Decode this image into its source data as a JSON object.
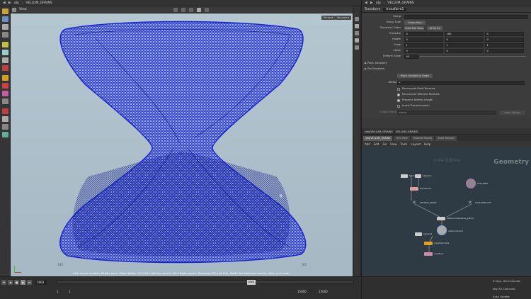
{
  "viewport": {
    "path": [
      "obj",
      "VELLUM_GRAINS"
    ],
    "title": "View",
    "persp_label": "Persp ▾",
    "cam_label": "No cam ▾",
    "grid_labels": [
      "-185",
      "185"
    ],
    "status_hint": "Left mouse tumbles. Middle pans. Right dollies. Ctrl+Alt+Left box-zooms. Ctrl+Right zooms. Spacebar-Ctrl-Left tilts. Hold L for alternate tumble, dolly, and zoom."
  },
  "timeline": {
    "current_frame": "1663",
    "marker_frame": "1663",
    "range_start": "1",
    "range_end": "15000"
  },
  "params": {
    "path": [
      "obj",
      "VELLUM_GRAINS"
    ],
    "node_type": "Transform",
    "node_name": "transform1",
    "fields": {
      "group": {
        "label": "Group"
      },
      "group_type": {
        "label": "Group Type",
        "value": "Guess from Group"
      },
      "transform_order": {
        "label": "Transform Order",
        "value": "Scale Rot Trans"
      },
      "rotate_order": {
        "value": "Rx Ry Rz"
      },
      "translate": {
        "label": "Translate",
        "values": [
          "0",
          "100",
          "0"
        ]
      },
      "rotate": {
        "label": "Rotate",
        "values": [
          "0",
          "0",
          "0"
        ]
      },
      "scale": {
        "label": "Scale",
        "values": [
          "1",
          "1",
          "1"
        ]
      },
      "shear": {
        "label": "Shear",
        "values": [
          "0",
          "0",
          "0"
        ]
      },
      "uniform_scale": {
        "label": "Uniform Scale",
        "value": "45"
      },
      "attributes": {
        "label": "Attributes",
        "value": "*"
      },
      "output_attribute": {
        "label": "Output Attribute",
        "value": "xform",
        "menu": "Point Attribu"
      }
    },
    "sections": [
      "▶ Point Transform",
      "▶ Pre-Transform"
    ],
    "move_centroid_label": "Move Centroid to Origin",
    "checkboxes": [
      {
        "label": "Recompute Point Normals"
      },
      {
        "label": "Recompute Affected Normals"
      },
      {
        "label": "Preserve Normal Length"
      },
      {
        "label": "Invert Transformation"
      }
    ]
  },
  "network": {
    "path": [
      "/obj/VELLUM_GRAINS",
      "VELLUM_GRAINS"
    ],
    "tabs": [
      "/obj/VELLUM_GRAINS",
      "Tree View",
      "Material Palette",
      "Asset Browser"
    ],
    "menu": [
      "Add",
      "Edit",
      "Go",
      "View",
      "Tools",
      "Layout",
      "Help"
    ],
    "watermark": "Indie Edition",
    "context": "Geometry",
    "nodes": [
      "fetch1",
      "sphere1",
      "transform1",
      "COLLIDER",
      "SOURCE_GRAIN",
      "COLLIDER_OUT",
      "vellumconstraints_grain1",
      "vellumsolver1",
      "sphere2",
      "copytopoints1",
      "out_final"
    ]
  },
  "status": {
    "keys": "0 keys, 0/0 channels",
    "key_all": "Key All Channels",
    "auto_update": "Auto Update"
  }
}
